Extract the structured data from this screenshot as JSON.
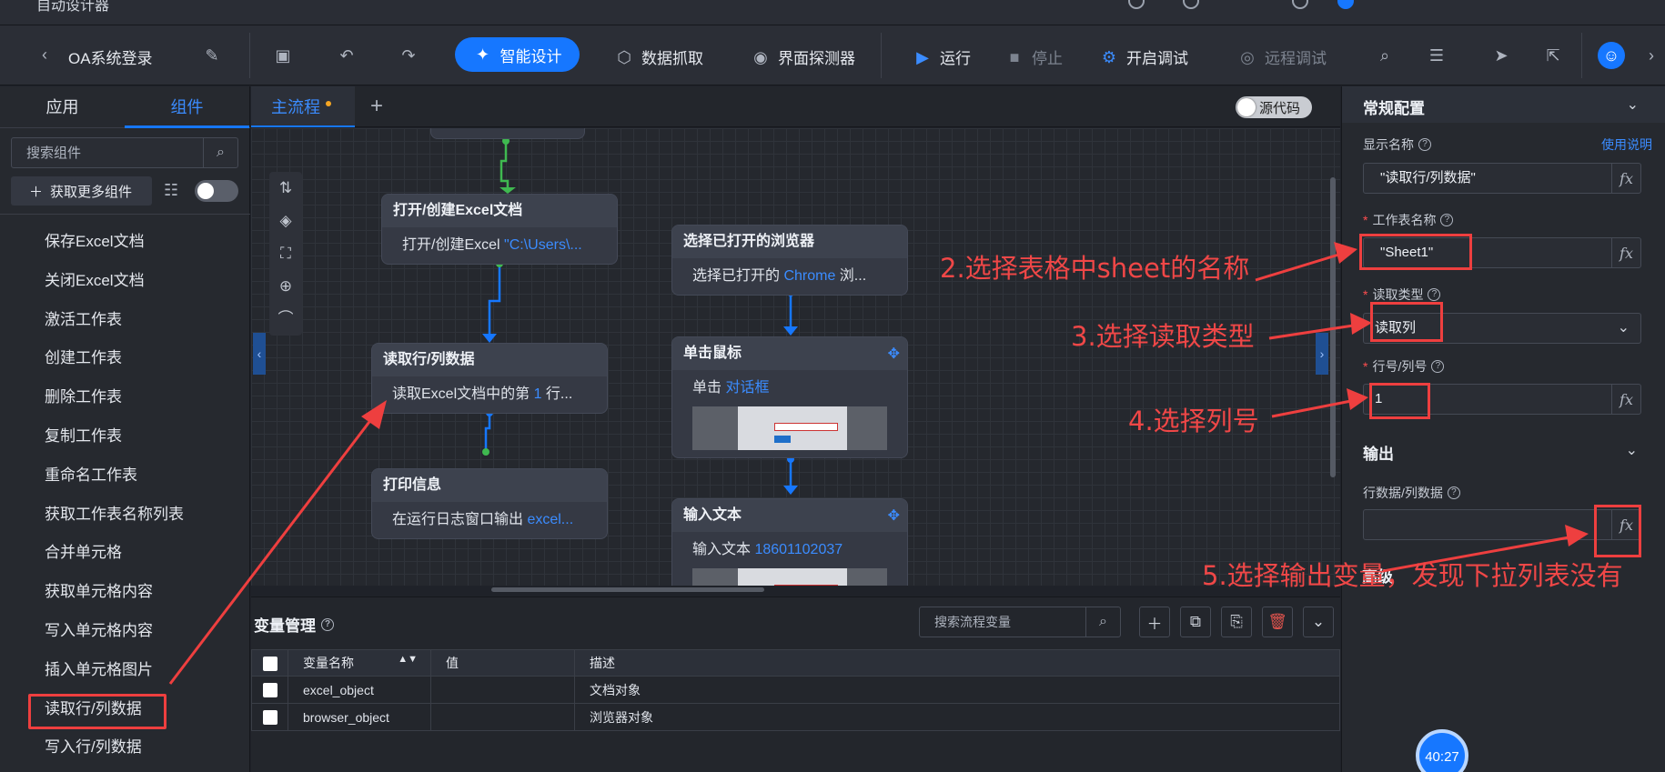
{
  "titlebar": {
    "title": "自动设计器"
  },
  "toolbar": {
    "project_name": "OA系统登录",
    "smart_design": "智能设计",
    "data_capture": "数据抓取",
    "ui_detector": "界面探测器",
    "run": "运行",
    "stop": "停止",
    "debug": "开启调试",
    "remote_debug": "远程调试"
  },
  "left_panel": {
    "tabs": [
      "应用",
      "组件"
    ],
    "active_tab": "组件",
    "search_placeholder": "搜索组件",
    "get_more_label": "获取更多组件",
    "components": [
      "保存Excel文档",
      "关闭Excel文档",
      "激活工作表",
      "创建工作表",
      "删除工作表",
      "复制工作表",
      "重命名工作表",
      "获取工作表名称列表",
      "合并单元格",
      "获取单元格内容",
      "写入单元格内容",
      "插入单元格图片",
      "读取行/列数据",
      "写入行/列数据"
    ],
    "selected_component": "读取行/列数据"
  },
  "canvas_tabs": {
    "main_tab": "主流程",
    "source_toggle": "源代码"
  },
  "flow_nodes": {
    "open_excel": {
      "title": "打开/创建Excel文档",
      "body_text": "打开/创建Excel ",
      "body_highlight": "\"C:\\Users\\..."
    },
    "read_rowcol": {
      "title": "读取行/列数据",
      "body_text": "读取Excel文档中的第 ",
      "body_highlight": "1",
      "body_suffix": " 行..."
    },
    "print_info": {
      "title": "打印信息",
      "body_text": "在运行日志窗口输出 ",
      "body_highlight": "excel..."
    },
    "select_browser": {
      "title": "选择已打开的浏览器",
      "body_text": "选择已打开的 ",
      "body_highlight": "Chrome",
      "body_suffix": " 浏..."
    },
    "click_mouse": {
      "title": "单击鼠标",
      "body_text": "单击 ",
      "body_highlight": "对话框"
    },
    "input_text": {
      "title": "输入文本",
      "body_text": "输入文本 ",
      "body_highlight": "18601102037"
    }
  },
  "variable_manager": {
    "title": "变量管理",
    "search_placeholder": "搜索流程变量",
    "columns": [
      "变量名称",
      "值",
      "描述"
    ],
    "rows": [
      {
        "name": "excel_object",
        "value": "",
        "description": "文档对象"
      },
      {
        "name": "browser_object",
        "value": "",
        "description": "浏览器对象"
      }
    ]
  },
  "right_panel": {
    "section_title": "常规配置",
    "help_link": "使用说明",
    "display_name_label": "显示名称",
    "display_name_value": "\"读取行/列数据\"",
    "sheet_name_label": "工作表名称",
    "sheet_name_value": "\"Sheet1\"",
    "read_type_label": "读取类型",
    "read_type_value": "读取列",
    "row_col_label": "行号/列号",
    "row_col_value": "1",
    "output_title": "输出",
    "output_label": "行数据/列数据",
    "output_value": "",
    "advanced_title": "高级"
  },
  "annotations": {
    "step2": "2.选择表格中sheet的名称",
    "step3": "3.选择读取类型",
    "step4": "4.选择列号",
    "step5": "5.选择输出变量，发现下拉列表没有"
  },
  "timer": "40:27",
  "colors": {
    "accent": "#1677ff",
    "annotation": "#ee3f3f",
    "background": "#1f2229"
  }
}
